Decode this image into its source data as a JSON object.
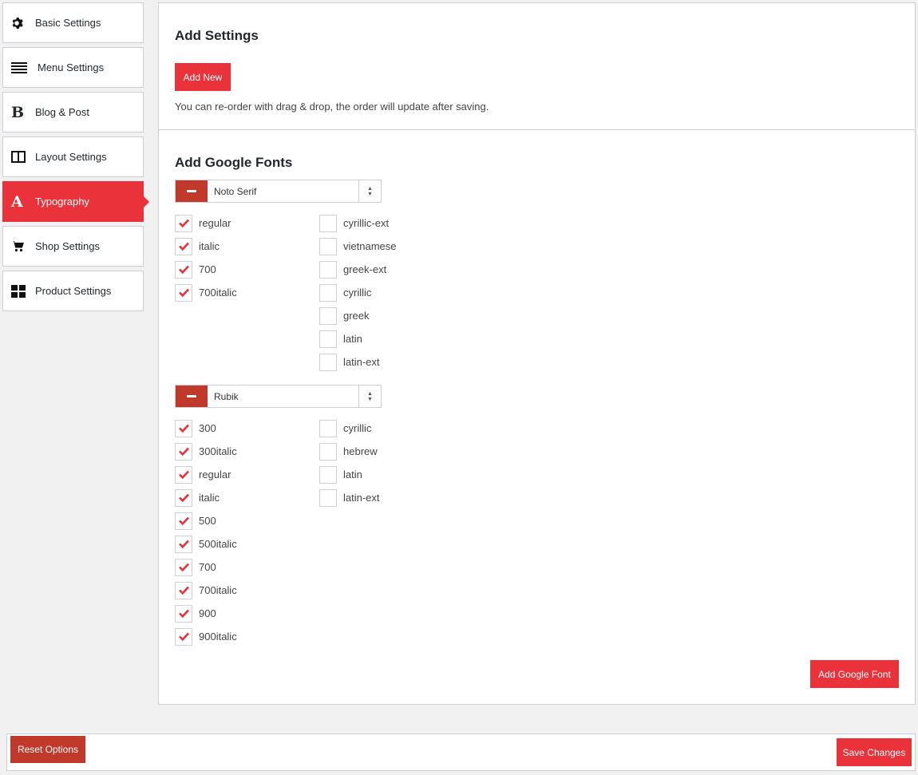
{
  "sidebar": {
    "items": [
      {
        "label": "Basic Settings",
        "icon": "gear-icon",
        "active": false
      },
      {
        "label": "Menu Settings",
        "icon": "menu-lines-icon",
        "active": false
      },
      {
        "label": "Blog & Post",
        "icon": "bold-b-icon",
        "active": false
      },
      {
        "label": "Layout Settings",
        "icon": "layout-columns-icon",
        "active": false
      },
      {
        "label": "Typography",
        "icon": "letter-a-icon",
        "active": true
      },
      {
        "label": "Shop Settings",
        "icon": "cart-icon",
        "active": false
      },
      {
        "label": "Product Settings",
        "icon": "grid-icon",
        "active": false
      }
    ]
  },
  "add_settings": {
    "title": "Add Settings",
    "add_new_label": "Add New",
    "hint": "You can re-order with drag & drop, the order will update after saving."
  },
  "google_fonts": {
    "title": "Add Google Fonts",
    "fonts": [
      {
        "name": "Noto Serif",
        "variants": [
          "regular",
          "italic",
          "700",
          "700italic"
        ],
        "variants_checked": [
          true,
          true,
          true,
          true
        ],
        "subsets": [
          "cyrillic-ext",
          "vietnamese",
          "greek-ext",
          "cyrillic",
          "greek",
          "latin",
          "latin-ext"
        ],
        "subsets_checked": [
          false,
          false,
          false,
          false,
          false,
          false,
          false
        ]
      },
      {
        "name": "Rubik",
        "variants": [
          "300",
          "300italic",
          "regular",
          "italic",
          "500",
          "500italic",
          "700",
          "700italic",
          "900",
          "900italic"
        ],
        "variants_checked": [
          true,
          true,
          true,
          true,
          true,
          true,
          true,
          true,
          true,
          true
        ],
        "subsets": [
          "cyrillic",
          "hebrew",
          "latin",
          "latin-ext"
        ],
        "subsets_checked": [
          false,
          false,
          false,
          false
        ]
      }
    ],
    "add_button_label": "Add Google Font"
  },
  "footer": {
    "reset_label": "Reset Options",
    "save_label": "Save Changes"
  },
  "colors": {
    "accent": "#e9323a",
    "accent_dark": "#c0392b",
    "border": "#ccd0d4"
  }
}
